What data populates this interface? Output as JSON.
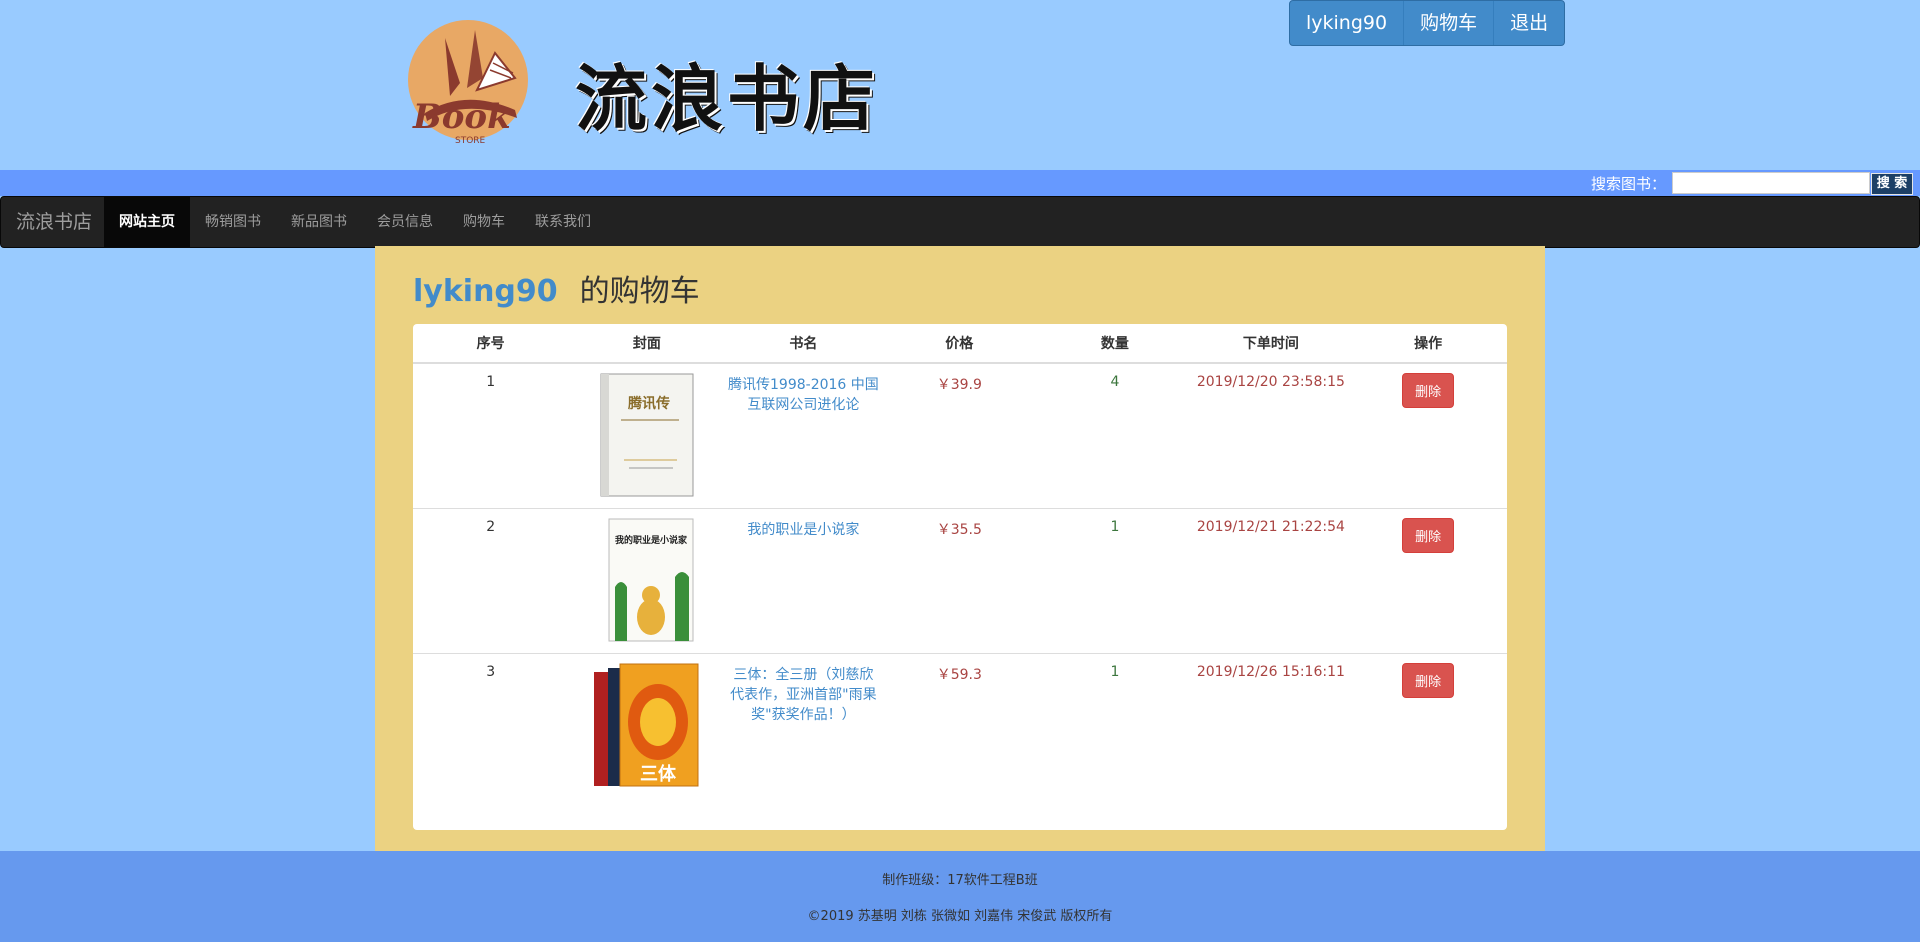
{
  "header": {
    "store_title": "流浪书店",
    "logo_text": "Book",
    "logo_subtext": "STORE",
    "user_buttons": [
      "lyking90",
      "购物车",
      "退出"
    ]
  },
  "search": {
    "label": "搜索图书：",
    "placeholder": "",
    "button": "搜 索"
  },
  "nav": {
    "brand": "流浪书店",
    "items": [
      "网站主页",
      "畅销图书",
      "新品图书",
      "会员信息",
      "购物车",
      "联系我们"
    ],
    "active": "网站主页"
  },
  "cart": {
    "user": "lyking90",
    "title_suffix": "的购物车",
    "columns": [
      "序号",
      "封面",
      "书名",
      "价格",
      "数量",
      "下单时间",
      "操作"
    ],
    "rows": [
      {
        "index": "1",
        "title": "腾讯传1998-2016 中国互联网公司进化论",
        "price": "￥39.9",
        "qty": "4",
        "time": "2019/12/20 23:58:15",
        "action": "删除",
        "cover_text": "腾讯传"
      },
      {
        "index": "2",
        "title": "我的职业是小说家",
        "price": "￥35.5",
        "qty": "1",
        "time": "2019/12/21 21:22:54",
        "action": "删除",
        "cover_text": "我的职业是小说家"
      },
      {
        "index": "3",
        "title": "三体：全三册（刘慈欣代表作，亚洲首部\"雨果奖\"获奖作品！）",
        "price": "￥59.3",
        "qty": "1",
        "time": "2019/12/26 15:16:11",
        "action": "删除",
        "cover_text": "三体"
      }
    ]
  },
  "footer": {
    "line1": "制作班级：17软件工程B班",
    "line2": "©2019 苏基明 刘栋 张微如 刘嘉伟 宋俊武 版权所有"
  },
  "colors": {
    "page_bg": "#99cbff",
    "search_bar": "#6699ff",
    "nav_bg": "#222222",
    "content_bg": "#ebd282",
    "link": "#428bca",
    "price": "#a94442",
    "qty": "#3c763d",
    "danger": "#d9534f"
  }
}
